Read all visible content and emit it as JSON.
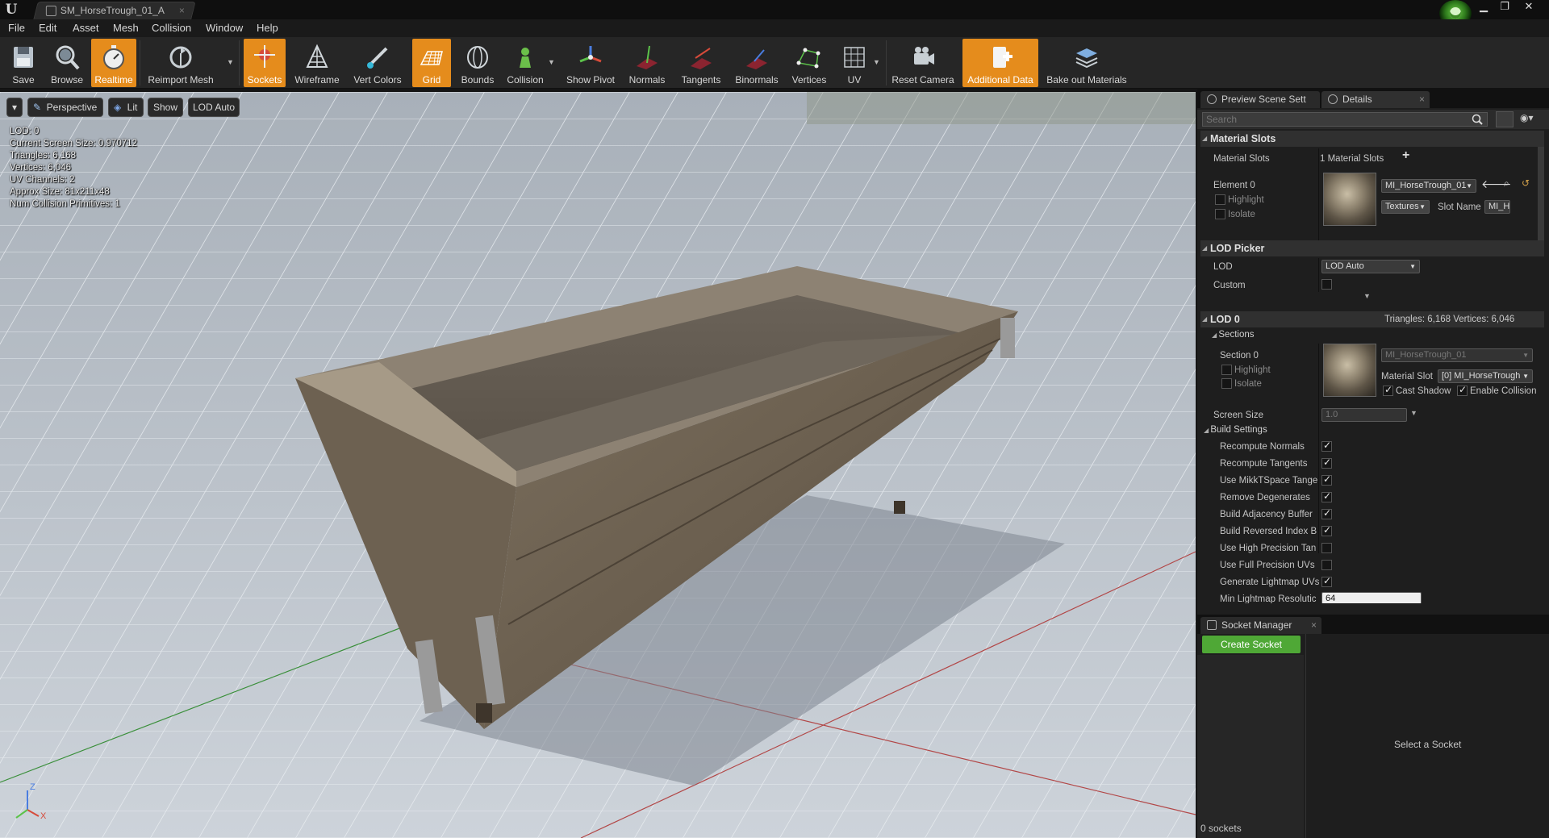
{
  "window": {
    "logo": "U",
    "tab_title": "SM_HorseTrough_01_A",
    "tab_close": "×",
    "minimize": "▁",
    "restore": "❐",
    "close": "✕"
  },
  "menu": [
    "File",
    "Edit",
    "Asset",
    "Mesh",
    "Collision",
    "Window",
    "Help"
  ],
  "toolbar": {
    "buttons": [
      {
        "label": "Save",
        "icon": "save-icon",
        "active": false
      },
      {
        "label": "Browse",
        "icon": "browse-icon",
        "active": false
      },
      {
        "label": "Realtime",
        "icon": "stopwatch-icon",
        "active": true
      },
      {
        "label": "Reimport Mesh",
        "icon": "reimport-icon",
        "active": false
      },
      {
        "label": "Sockets",
        "icon": "sockets-icon",
        "active": true
      },
      {
        "label": "Wireframe",
        "icon": "wireframe-icon",
        "active": false
      },
      {
        "label": "Vert Colors",
        "icon": "vert-colors-icon",
        "active": false
      },
      {
        "label": "Grid",
        "icon": "grid-icon",
        "active": true
      },
      {
        "label": "Bounds",
        "icon": "bounds-icon",
        "active": false
      },
      {
        "label": "Collision",
        "icon": "collision-icon",
        "active": false
      },
      {
        "label": "Show Pivot",
        "icon": "pivot-icon",
        "active": false
      },
      {
        "label": "Normals",
        "icon": "normals-icon",
        "active": false
      },
      {
        "label": "Tangents",
        "icon": "tangents-icon",
        "active": false
      },
      {
        "label": "Binormals",
        "icon": "binormals-icon",
        "active": false
      },
      {
        "label": "Vertices",
        "icon": "vertices-icon",
        "active": false
      },
      {
        "label": "UV",
        "icon": "uv-icon",
        "active": false
      },
      {
        "label": "Reset Camera",
        "icon": "camera-icon",
        "active": false
      },
      {
        "label": "Additional Data",
        "icon": "additional-data-icon",
        "active": true
      },
      {
        "label": "Bake out Materials",
        "icon": "bake-materials-icon",
        "active": false
      }
    ]
  },
  "viewport": {
    "dropdown_arrow": "▾",
    "perspective": "Perspective",
    "lit": "Lit",
    "show": "Show",
    "lod": "LOD Auto",
    "stats": [
      "LOD:  0",
      "Current Screen Size:  0.970712",
      "Triangles:  6,168",
      "Vertices:  6,046",
      "UV Channels:  2",
      "Approx Size: 81x211x48",
      "Num Collision Primitives:  1"
    ],
    "axis_z": "Z",
    "axis_x": "X"
  },
  "panel_tabs": {
    "preview": "Preview Scene Sett",
    "details": "Details",
    "close": "×"
  },
  "details": {
    "search_placeholder": "Search",
    "material_slots_cat": "Material Slots",
    "material_slots_label": "Material Slots",
    "material_slots_count": "1 Material Slots",
    "add_symbol": "+",
    "element0": "Element 0",
    "highlight": "Highlight",
    "isolate": "Isolate",
    "material_name": "MI_HorseTrough_01",
    "textures": "Textures",
    "slot_name_label": "Slot Name",
    "slot_name_value": "MI_H",
    "lod_picker_cat": "LOD Picker",
    "lod_label": "LOD",
    "lod_value": "LOD Auto",
    "custom_label": "Custom",
    "lod0_cat": "LOD 0",
    "lod0_stats": "Triangles: 6,168   Vertices: 6,046",
    "sections": "Sections",
    "section0": "Section 0",
    "section_material": "MI_HorseTrough_01",
    "material_slot_label": "Material Slot",
    "material_slot_value": "[0] MI_HorseTrough",
    "cast_shadow": "Cast Shadow",
    "enable_collision": "Enable Collision",
    "screen_size_label": "Screen Size",
    "screen_size_value": "1.0",
    "build_settings": "Build Settings",
    "build_rows": [
      {
        "label": "Recompute Normals",
        "checked": true
      },
      {
        "label": "Recompute Tangents",
        "checked": true
      },
      {
        "label": "Use MikkTSpace Tange",
        "checked": true
      },
      {
        "label": "Remove Degenerates",
        "checked": true
      },
      {
        "label": "Build Adjacency Buffer",
        "checked": true
      },
      {
        "label": "Build Reversed Index B",
        "checked": true
      },
      {
        "label": "Use High Precision Tan",
        "checked": false
      },
      {
        "label": "Use Full Precision UVs",
        "checked": false
      },
      {
        "label": "Generate Lightmap UVs",
        "checked": true
      }
    ],
    "min_lightmap_label": "Min Lightmap Resolutic",
    "min_lightmap_value": "64"
  },
  "socket_manager": {
    "tab": "Socket Manager",
    "create": "Create Socket",
    "empty": "Select a Socket",
    "count": "0 sockets"
  }
}
